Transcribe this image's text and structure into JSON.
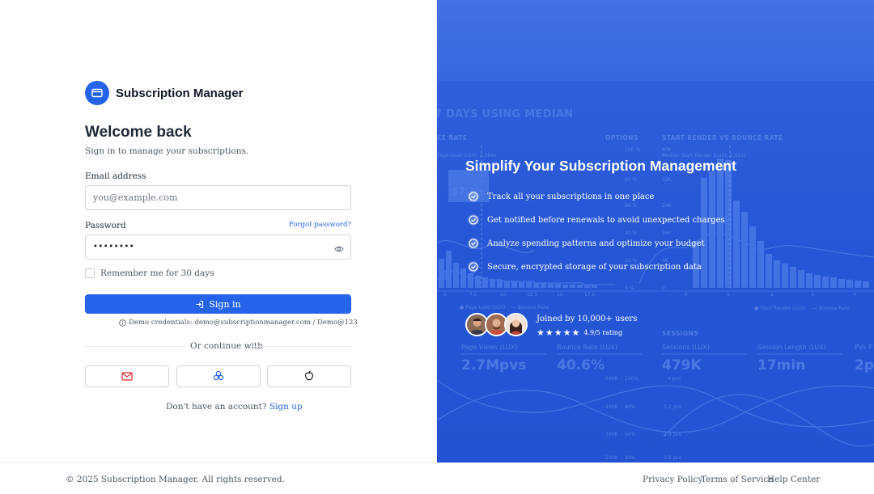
{
  "brand": {
    "name": "Subscription Manager",
    "icon": "credit-card-icon",
    "color": "#2563eb"
  },
  "login": {
    "title": "Welcome back",
    "subtitle": "Sign in to manage your subscriptions.",
    "email_label": "Email address",
    "email_placeholder": "you@example.com",
    "password_label": "Password",
    "forgot_label": "Forgot password?",
    "password_value": "••••••••",
    "remember_label": "Remember me for 30 days",
    "remember_checked": false,
    "signin_label": "Sign in",
    "demo_text": "Demo credentials: demo@subscriptionmanager.com / Demo@123",
    "or_text": "Or continue with",
    "social": [
      {
        "name": "email",
        "icon": "mail-icon"
      },
      {
        "name": "linked-circles",
        "icon": "network-icon"
      },
      {
        "name": "apple",
        "icon": "apple-icon"
      }
    ],
    "signup_prompt": "Don't have an account?",
    "signup_link": "Sign up"
  },
  "hero": {
    "title": "Simplify Your Subscription Management",
    "features": [
      "Track all your subscriptions in one place",
      "Get notified before renewals to avoid unexpected charges",
      "Analyze spending patterns and optimize your budget",
      "Secure, encrypted storage of your subscription data"
    ],
    "joined": "Joined by 10,000+ users",
    "rating": "4.9/5 rating",
    "stars": 5
  },
  "background_dashboard": {
    "heading": "7 DAYS USING MEDIAN",
    "labels": [
      "CE RATE",
      "OPTIONS",
      "START RENDER VS BOUNCE RATE",
      "SESSIONS"
    ],
    "metrics": [
      {
        "label": "Page Views (LUX)",
        "value": "2.7Mpvs"
      },
      {
        "label": "Bounce Rate (LUX)",
        "value": "40.6%"
      },
      {
        "label": "Sessions (LUX)",
        "value": "479K"
      },
      {
        "label": "Session Length (LUX)",
        "value": "17min"
      },
      {
        "label": "PVs P",
        "value": "2p"
      }
    ],
    "overlay_value": "57.1%"
  },
  "footer": {
    "copyright": "© 2025 Subscription Manager. All rights reserved.",
    "links": [
      "Privacy Policy",
      "Terms of Service",
      "Help Center"
    ]
  }
}
